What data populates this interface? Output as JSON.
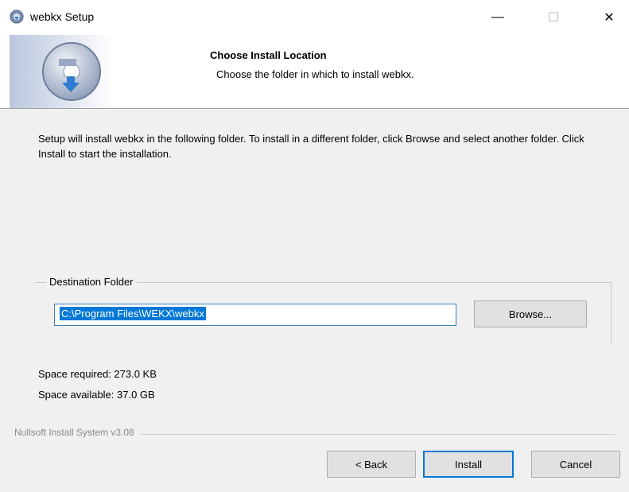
{
  "window": {
    "title": "webkx Setup",
    "minimize_glyph": "—",
    "maximize_glyph": "☐",
    "close_glyph": "✕"
  },
  "header": {
    "title": "Choose Install Location",
    "subtitle": "Choose the folder in which to install webkx."
  },
  "intro": "Setup will install webkx in the following folder. To install in a different folder, click Browse and select another folder. Click Install to start the installation.",
  "destination": {
    "group_label": "Destination Folder",
    "path": "C:\\Program Files\\WEKX\\webkx",
    "browse_label": "Browse..."
  },
  "space": {
    "required": "Space required: 273.0 KB",
    "available": "Space available: 37.0 GB"
  },
  "branding": "Nullsoft Install System v3.08",
  "buttons": {
    "back": "< Back",
    "install": "Install",
    "cancel": "Cancel"
  },
  "colors": {
    "accent": "#0078d7",
    "dialog_bg": "#f0f0f0"
  }
}
